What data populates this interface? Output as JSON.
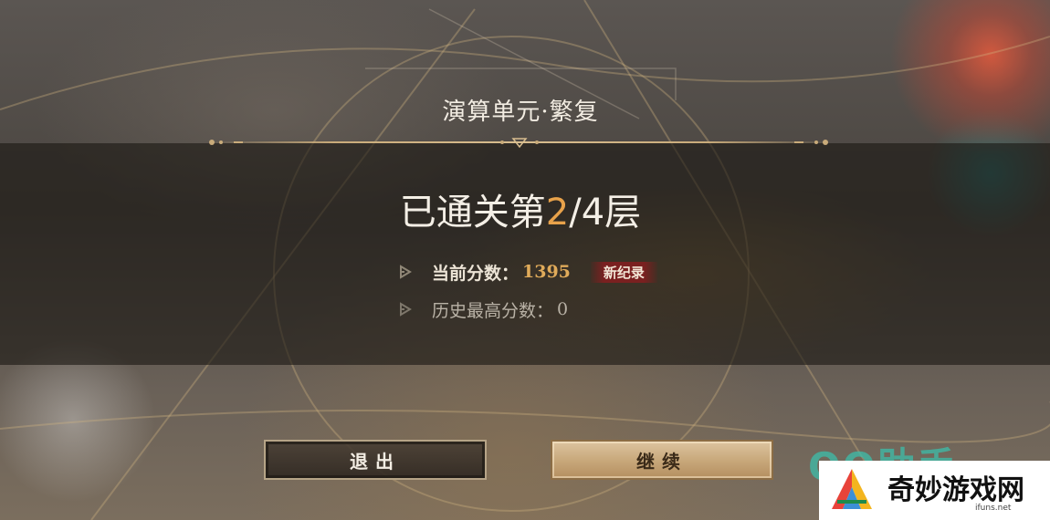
{
  "stage_title": "演算单元·繁复",
  "progress": {
    "prefix": "已通关第",
    "current": "2",
    "suffix": "/4层"
  },
  "current_score": {
    "label": "当前分数：",
    "value": "1395",
    "badge": "新纪录"
  },
  "best_score": {
    "label": "历史最高分数：",
    "value": "0"
  },
  "buttons": {
    "exit": "退出",
    "continue": "继续"
  },
  "watermark": {
    "qq_text": "QQ助手",
    "site_name": "奇妙游戏网",
    "url": "ifuns.net"
  },
  "colors": {
    "accent_orange": "#e8a24a",
    "score_gold": "#e0ab5a",
    "badge_red": "#7a2020",
    "line_gold": "#c9ab7a"
  }
}
